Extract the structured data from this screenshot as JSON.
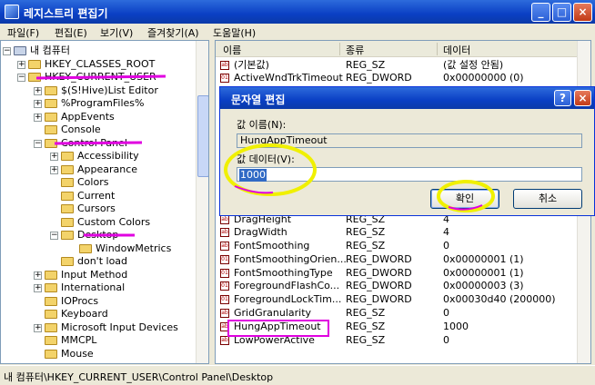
{
  "window": {
    "title": "레지스트리 편집기"
  },
  "title_buttons": {
    "minimize": "_",
    "maximize": "□",
    "close": "×"
  },
  "menu": [
    "파일(F)",
    "편집(E)",
    "보기(V)",
    "즐겨찾기(A)",
    "도움말(H)"
  ],
  "tree": {
    "items": [
      {
        "label": "내 컴퓨터",
        "expander": "−"
      },
      {
        "label": "HKEY_CLASSES_ROOT",
        "expander": "+"
      },
      {
        "label": "HKEY_CURRENT_USER",
        "expander": "−"
      },
      {
        "label": "$(S!Hive)List Editor",
        "expander": "+"
      },
      {
        "label": "%ProgramFiles%",
        "expander": "+"
      },
      {
        "label": "AppEvents",
        "expander": "+"
      },
      {
        "label": "Console",
        "expander": ""
      },
      {
        "label": "Control Panel",
        "expander": "−"
      },
      {
        "label": "Accessibility",
        "expander": "+"
      },
      {
        "label": "Appearance",
        "expander": "+"
      },
      {
        "label": "Colors",
        "expander": ""
      },
      {
        "label": "Current",
        "expander": ""
      },
      {
        "label": "Cursors",
        "expander": ""
      },
      {
        "label": "Custom Colors",
        "expander": ""
      },
      {
        "label": "Desktop",
        "expander": "−"
      },
      {
        "label": "WindowMetrics",
        "expander": ""
      },
      {
        "label": "don't load",
        "expander": ""
      },
      {
        "label": "Input Method",
        "expander": "+"
      },
      {
        "label": "International",
        "expander": "+"
      },
      {
        "label": "IOProcs",
        "expander": ""
      },
      {
        "label": "Keyboard",
        "expander": ""
      },
      {
        "label": "Microsoft Input Devices",
        "expander": "+"
      },
      {
        "label": "MMCPL",
        "expander": ""
      },
      {
        "label": "Mouse",
        "expander": ""
      }
    ]
  },
  "list": {
    "columns": [
      "이름",
      "종류",
      "데이터"
    ],
    "rows": [
      {
        "name": "(기본값)",
        "type": "REG_SZ",
        "data": "(값 설정 안됨)"
      },
      {
        "name": "ActiveWndTrkTimeout",
        "type": "REG_DWORD",
        "data": "0x00000000 (0)"
      },
      {
        "name": "DragHeight",
        "type": "REG_SZ",
        "data": "4"
      },
      {
        "name": "DragWidth",
        "type": "REG_SZ",
        "data": "4"
      },
      {
        "name": "FontSmoothing",
        "type": "REG_SZ",
        "data": "0"
      },
      {
        "name": "FontSmoothingOrien...",
        "type": "REG_DWORD",
        "data": "0x00000001 (1)"
      },
      {
        "name": "FontSmoothingType",
        "type": "REG_DWORD",
        "data": "0x00000001 (1)"
      },
      {
        "name": "ForegroundFlashCo...",
        "type": "REG_DWORD",
        "data": "0x00000003 (3)"
      },
      {
        "name": "ForegroundLockTim...",
        "type": "REG_DWORD",
        "data": "0x00030d40 (200000)"
      },
      {
        "name": "GridGranularity",
        "type": "REG_SZ",
        "data": "0"
      },
      {
        "name": "HungAppTimeout",
        "type": "REG_SZ",
        "data": "1000"
      },
      {
        "name": "LowPowerActive",
        "type": "REG_SZ",
        "data": "0"
      }
    ]
  },
  "statusbar": {
    "text": "내 컴퓨터\\HKEY_CURRENT_USER\\Control Panel\\Desktop"
  },
  "dialog": {
    "title": "문자열 편집",
    "help": "?",
    "close": "×",
    "name_label": "값 이름(N):",
    "name_value": "HungAppTimeout",
    "data_label": "값 데이터(V):",
    "data_value": "1000",
    "ok": "확인",
    "cancel": "취소"
  },
  "colors": {
    "annotation_magenta": "#e000e0",
    "annotation_yellow": "#f0f000"
  }
}
